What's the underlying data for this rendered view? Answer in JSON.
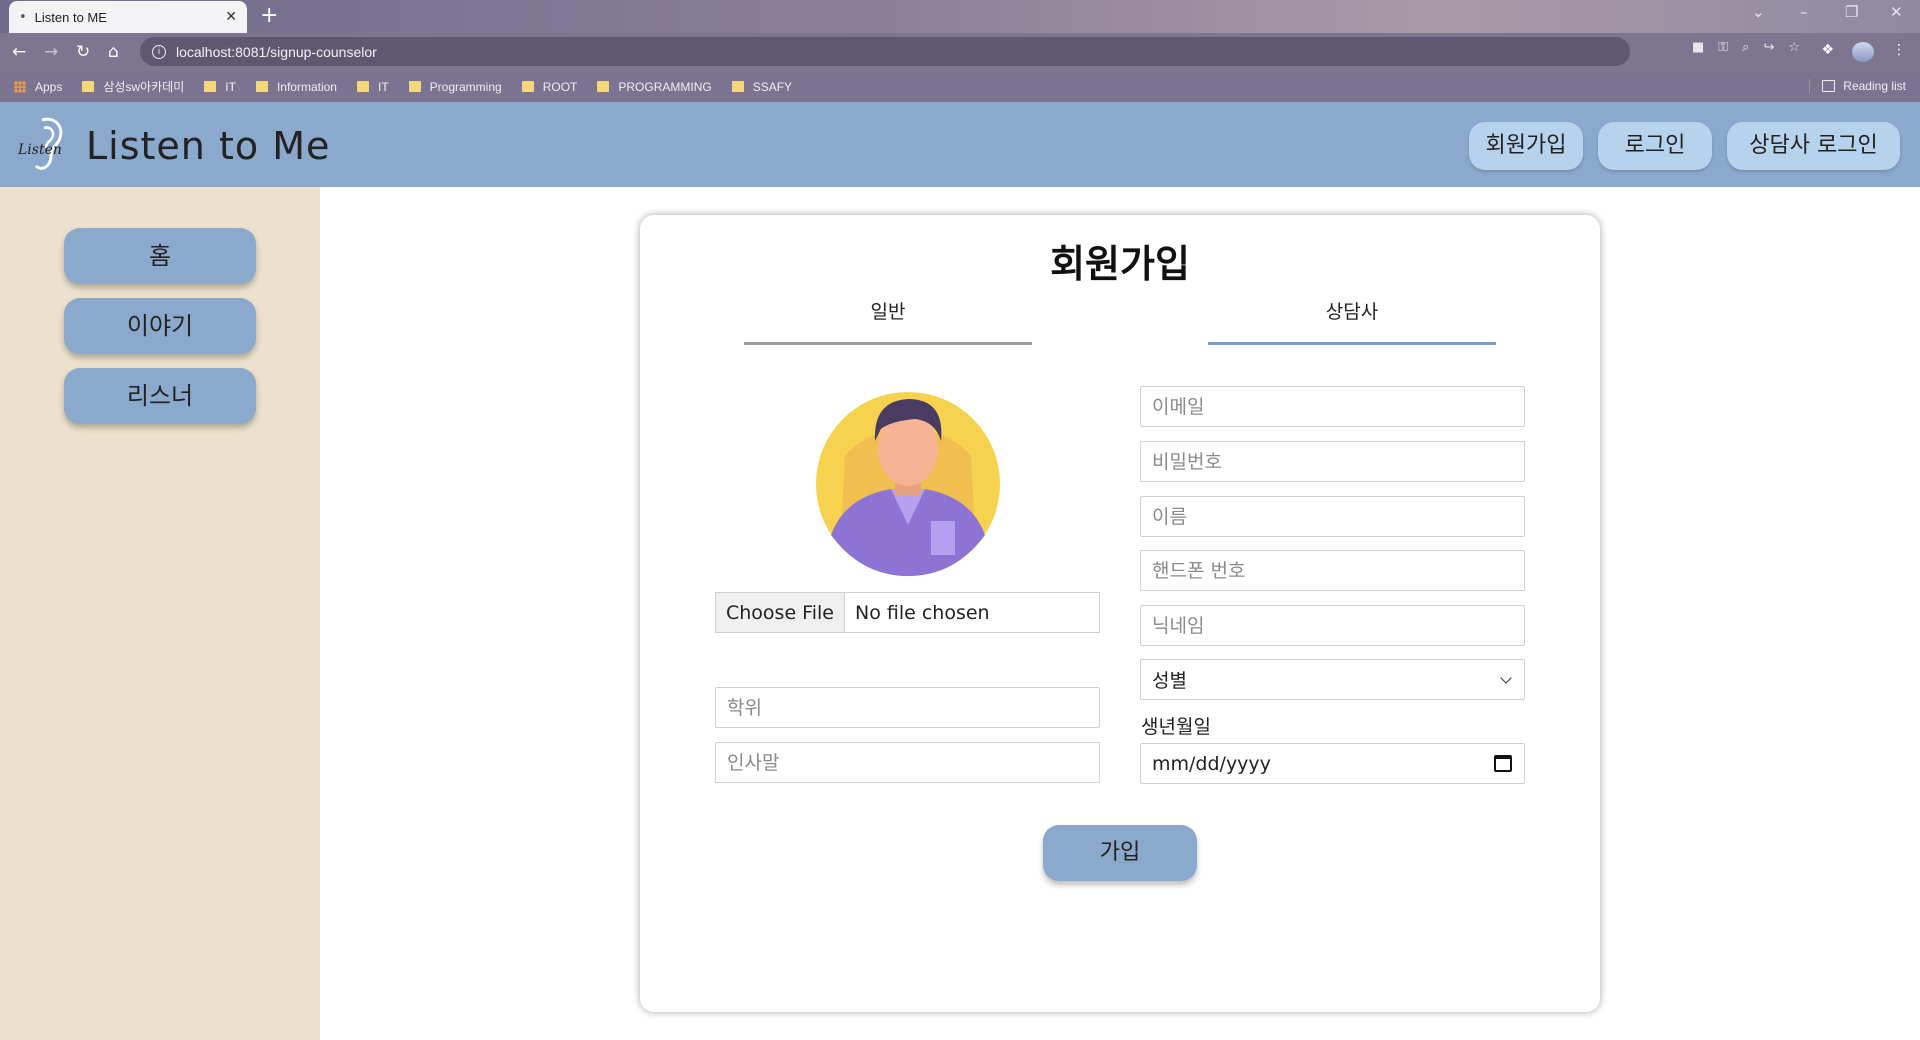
{
  "browser": {
    "tab_title": "Listen to ME",
    "url": "localhost:8081/signup-counselor",
    "bookmarks": [
      "Apps",
      "삼성sw아카데미",
      "IT",
      "Information",
      "IT",
      "Programming",
      "ROOT",
      "PROGRAMMING",
      "SSAFY"
    ],
    "reading_list": "Reading list"
  },
  "header": {
    "brand": "Listen to Me",
    "logo_text": "Listen",
    "signup_label": "회원가입",
    "login_label": "로그인",
    "counselor_login_label": "상담사 로그인"
  },
  "sidebar": {
    "items": [
      {
        "label": "홈"
      },
      {
        "label": "이야기"
      },
      {
        "label": "리스너"
      }
    ]
  },
  "form": {
    "title": "회원가입",
    "tabs": [
      {
        "label": "일반",
        "active": false
      },
      {
        "label": "상담사",
        "active": true
      }
    ],
    "file_button": "Choose File",
    "file_status": "No file chosen",
    "degree_placeholder": "학위",
    "greeting_placeholder": "인사말",
    "email_placeholder": "이메일",
    "password_placeholder": "비밀번호",
    "name_placeholder": "이름",
    "phone_placeholder": "핸드폰 번호",
    "nickname_placeholder": "닉네임",
    "gender_selected": "성별",
    "birthdate_label": "생년월일",
    "birthdate_value": "mm/dd/yyyy",
    "submit_label": "가입"
  },
  "colors": {
    "header_bg": "#8aa9cc",
    "button_bg": "#8aa9cc",
    "header_button_bg": "#b6d2ec",
    "sidebar_bg": "#ebe1cc",
    "active_tab_line": "#7b9ccf",
    "inactive_tab_line": "#9e9e9e"
  }
}
